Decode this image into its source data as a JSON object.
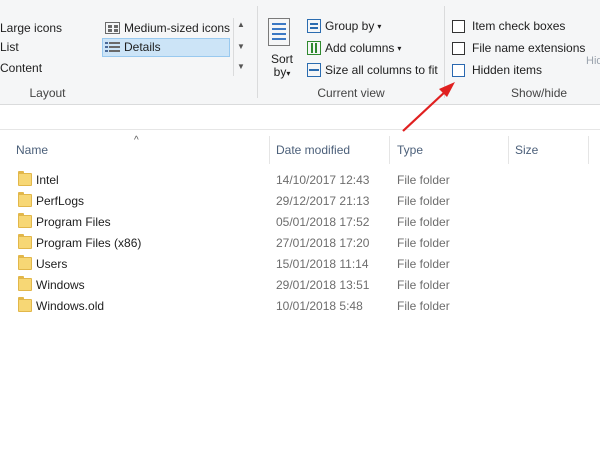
{
  "ribbon": {
    "layout": {
      "label": "Layout",
      "items": [
        "Large icons",
        "List",
        "Content",
        "Medium-sized icons",
        "Details"
      ]
    },
    "current_view": {
      "label": "Current view",
      "sort_line1": "Sort",
      "sort_line2": "by",
      "group_by": "Group by",
      "add_columns": "Add columns",
      "size_all": "Size all columns to fit"
    },
    "show_hide": {
      "label": "Show/hide",
      "item_check_boxes": "Item check boxes",
      "file_name_extensions": "File name extensions",
      "hidden_items": "Hidden items",
      "hide_cut": "Hid"
    }
  },
  "columns": {
    "name": "Name",
    "date_modified": "Date modified",
    "type": "Type",
    "size": "Size"
  },
  "files": [
    {
      "name": "Intel",
      "date": "14/10/2017 12:43",
      "type": "File folder"
    },
    {
      "name": "PerfLogs",
      "date": "29/12/2017 21:13",
      "type": "File folder"
    },
    {
      "name": "Program Files",
      "date": "05/01/2018 17:52",
      "type": "File folder"
    },
    {
      "name": "Program Files (x86)",
      "date": "27/01/2018 17:20",
      "type": "File folder"
    },
    {
      "name": "Users",
      "date": "15/01/2018 11:14",
      "type": "File folder"
    },
    {
      "name": "Windows",
      "date": "29/01/2018 13:51",
      "type": "File folder"
    },
    {
      "name": "Windows.old",
      "date": "10/01/2018 5:48",
      "type": "File folder"
    }
  ],
  "colors": {
    "selection": "#cce4f7",
    "annotation_arrow": "#e02020",
    "folder": "#f7d775"
  }
}
